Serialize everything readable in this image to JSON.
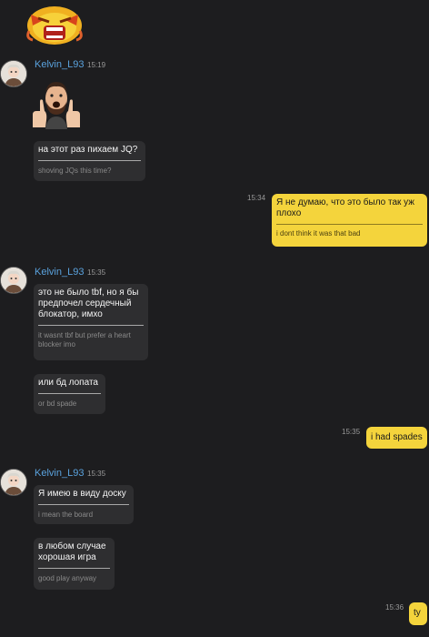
{
  "chat": {
    "top_sticker": "angry-emoji-sticker",
    "group1": {
      "username": "Kelvin_L93",
      "time": "15:19",
      "sticker": "thumbs-up-man-sticker",
      "messages": [
        {
          "text": "на этот раз пихаем JQ?",
          "translation": "shoving JQs this time?"
        }
      ]
    },
    "own1": {
      "time": "15:34",
      "text": "Я не думаю, что это было так уж плохо",
      "translation": "i dont think it was that bad"
    },
    "group2": {
      "username": "Kelvin_L93",
      "time": "15:35",
      "messages": [
        {
          "text": "это не было tbf, но я бы предпочел сердечный блокатор, имхо",
          "translation": "it wasnt tbf but prefer a heart blocker imo"
        },
        {
          "text": "или бд лопата",
          "translation": "or bd spade"
        }
      ]
    },
    "own2": {
      "time": "15:35",
      "text": "i had spades"
    },
    "group3": {
      "username": "Kelvin_L93",
      "time": "15:35",
      "messages": [
        {
          "text": "Я имею в виду доску",
          "translation": "i mean the board"
        },
        {
          "text": "в любом случае хорошая игра",
          "translation": "good play anyway"
        }
      ]
    },
    "own3": {
      "time": "15:36",
      "text": "ty"
    }
  },
  "colors": {
    "background": "#1d1d1f",
    "incoming_bubble": "#2e2e30",
    "outgoing_bubble": "#f4d43c",
    "username": "#5aa2dd"
  }
}
